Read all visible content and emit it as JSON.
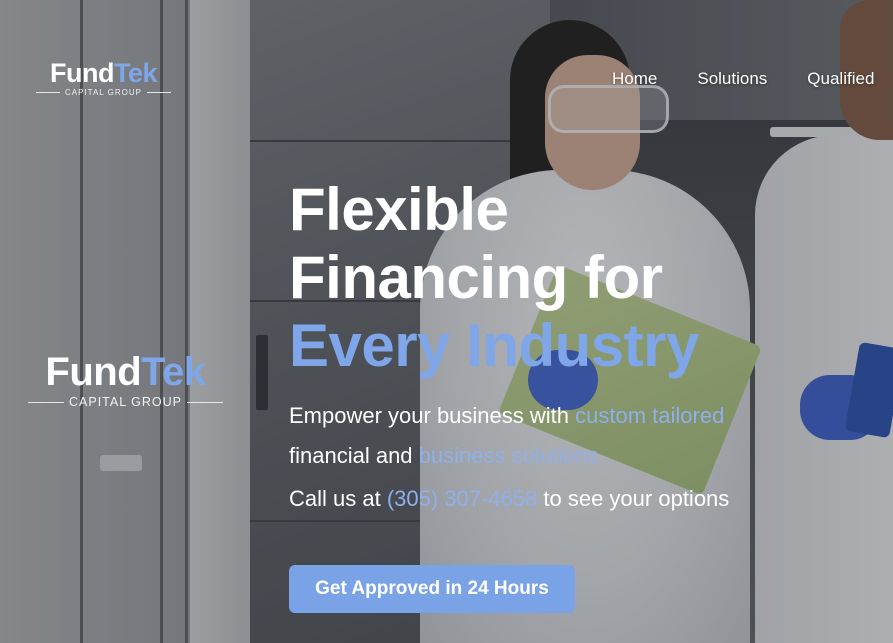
{
  "brand": {
    "name_primary": "Fund",
    "name_accent": "Tek",
    "tagline": "CAPITAL GROUP",
    "accent_color": "#7fa6e8"
  },
  "nav": {
    "items": [
      {
        "label": "Home"
      },
      {
        "label": "Solutions"
      },
      {
        "label": "Qualified"
      }
    ]
  },
  "hero": {
    "title_line1": "Flexible",
    "title_line2": "Financing for",
    "title_line3": "Every Industry",
    "lead_part1": "Empower your business with ",
    "lead_link1": "custom tailored",
    "lead_part2": "financial and ",
    "lead_link2": "business solutions",
    "call_prefix": "Call us at ",
    "phone": "(305) 307-4658",
    "call_suffix": " to see your options",
    "cta_label": "Get Approved in 24 Hours"
  }
}
